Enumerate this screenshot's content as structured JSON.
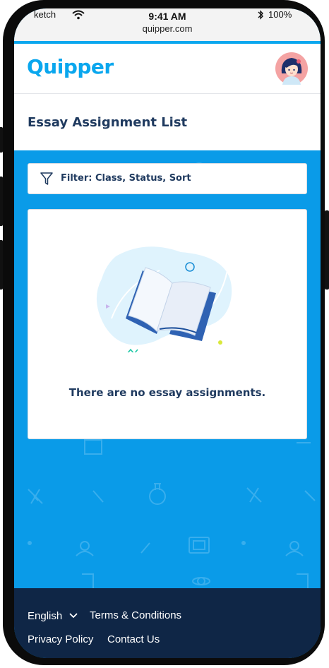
{
  "status": {
    "carrier": "ketch",
    "time": "9:41 AM",
    "url": "quipper.com",
    "battery": "100%"
  },
  "header": {
    "logo": "Quipper"
  },
  "page": {
    "title": "Essay Assignment List"
  },
  "filter": {
    "label": "Filter: Class, Status, Sort"
  },
  "empty_state": {
    "message": "There are no essay assignments."
  },
  "footer": {
    "language": "English",
    "terms": "Terms & Conditions",
    "privacy": "Privacy Policy",
    "contact": "Contact Us"
  },
  "colors": {
    "brand": "#0aa7ee",
    "content_bg": "#0a9be8",
    "title_text": "#1f3a5f",
    "footer_bg": "#0f2646"
  }
}
